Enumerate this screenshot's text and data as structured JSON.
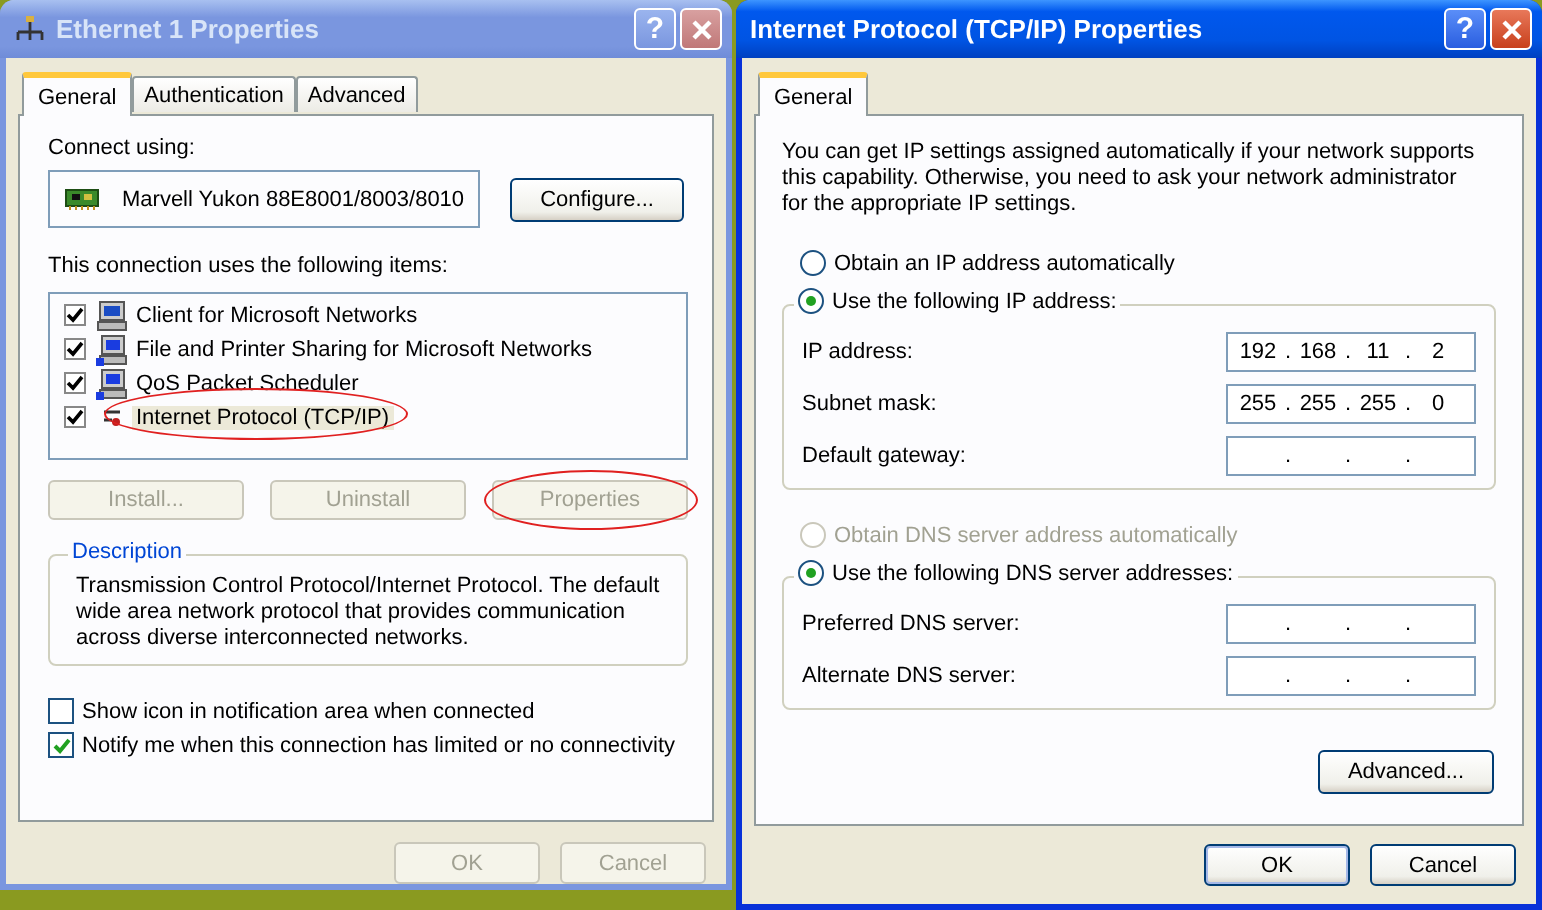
{
  "adapter_properties": {
    "title": "Ethernet 1 Properties",
    "active": false,
    "help": "?",
    "tabs": [
      {
        "label": "General",
        "selected": true
      },
      {
        "label": "Authentication",
        "selected": false
      },
      {
        "label": "Advanced",
        "selected": false
      }
    ],
    "connect_label": "Connect using:",
    "adapter": "Marvell Yukon 88E8001/8003/8010",
    "configure": "Configure...",
    "items_label": "This connection uses the following items:",
    "items": [
      {
        "label": "Client for Microsoft Networks",
        "kind": "client",
        "checked": true,
        "selected": false,
        "circled": false
      },
      {
        "label": "File and Printer Sharing for Microsoft Networks",
        "kind": "service",
        "checked": true,
        "selected": false,
        "circled": false
      },
      {
        "label": "QoS Packet Scheduler",
        "kind": "service",
        "checked": true,
        "selected": false,
        "circled": false
      },
      {
        "label": "Internet Protocol (TCP/IP)",
        "kind": "protocol",
        "checked": true,
        "selected": true,
        "circled": true
      }
    ],
    "item_buttons": [
      {
        "label": "Install...",
        "disabled": true,
        "circled": false
      },
      {
        "label": "Uninstall",
        "disabled": true,
        "circled": false
      },
      {
        "label": "Properties",
        "disabled": true,
        "circled": true
      }
    ],
    "description": {
      "title": "Description",
      "text": "Transmission Control Protocol/Internet Protocol. The default wide area network protocol that provides communication across diverse interconnected networks."
    },
    "options": [
      {
        "label": "Show icon in notification area when connected",
        "checked": false
      },
      {
        "label": "Notify me when this connection has limited or no connectivity",
        "checked": true
      }
    ],
    "buttons": [
      {
        "label": "OK",
        "disabled": true,
        "default": false
      },
      {
        "label": "Cancel",
        "disabled": true,
        "default": false
      }
    ]
  },
  "tcpip_properties": {
    "title": "Internet Protocol (TCP/IP) Properties",
    "active": true,
    "help": "?",
    "tabs": [
      {
        "label": "General",
        "selected": true
      }
    ],
    "intro": "You can get IP settings assigned automatically if your network supports this capability. Otherwise, you need to ask your network administrator for the appropriate IP settings.",
    "ip_mode": [
      {
        "label": "Obtain an IP address automatically",
        "selected": false,
        "disabled": false
      },
      {
        "label": "Use the following IP address:",
        "selected": true,
        "disabled": false
      }
    ],
    "ip_fields": [
      {
        "label": "IP address:",
        "octets": [
          "192",
          "168",
          "11",
          "2"
        ],
        "separators": [
          ".",
          ".",
          "."
        ]
      },
      {
        "label": "Subnet mask:",
        "octets": [
          "255",
          "255",
          "255",
          "0"
        ],
        "separators": [
          ".",
          ".",
          "."
        ]
      },
      {
        "label": "Default gateway:",
        "separators": [
          ".",
          ".",
          "."
        ]
      }
    ],
    "dns_mode": [
      {
        "label": "Obtain DNS server address automatically",
        "selected": false,
        "disabled": true
      },
      {
        "label": "Use the following DNS server addresses:",
        "selected": true,
        "disabled": false
      }
    ],
    "dns_fields": [
      {
        "label": "Preferred DNS server:",
        "separators": [
          ".",
          ".",
          "."
        ]
      },
      {
        "label": "Alternate DNS server:",
        "separators": [
          ".",
          ".",
          "."
        ]
      }
    ],
    "advanced": "Advanced...",
    "buttons": [
      {
        "label": "OK",
        "disabled": false,
        "default": true
      },
      {
        "label": "Cancel",
        "disabled": false,
        "default": false
      }
    ]
  }
}
